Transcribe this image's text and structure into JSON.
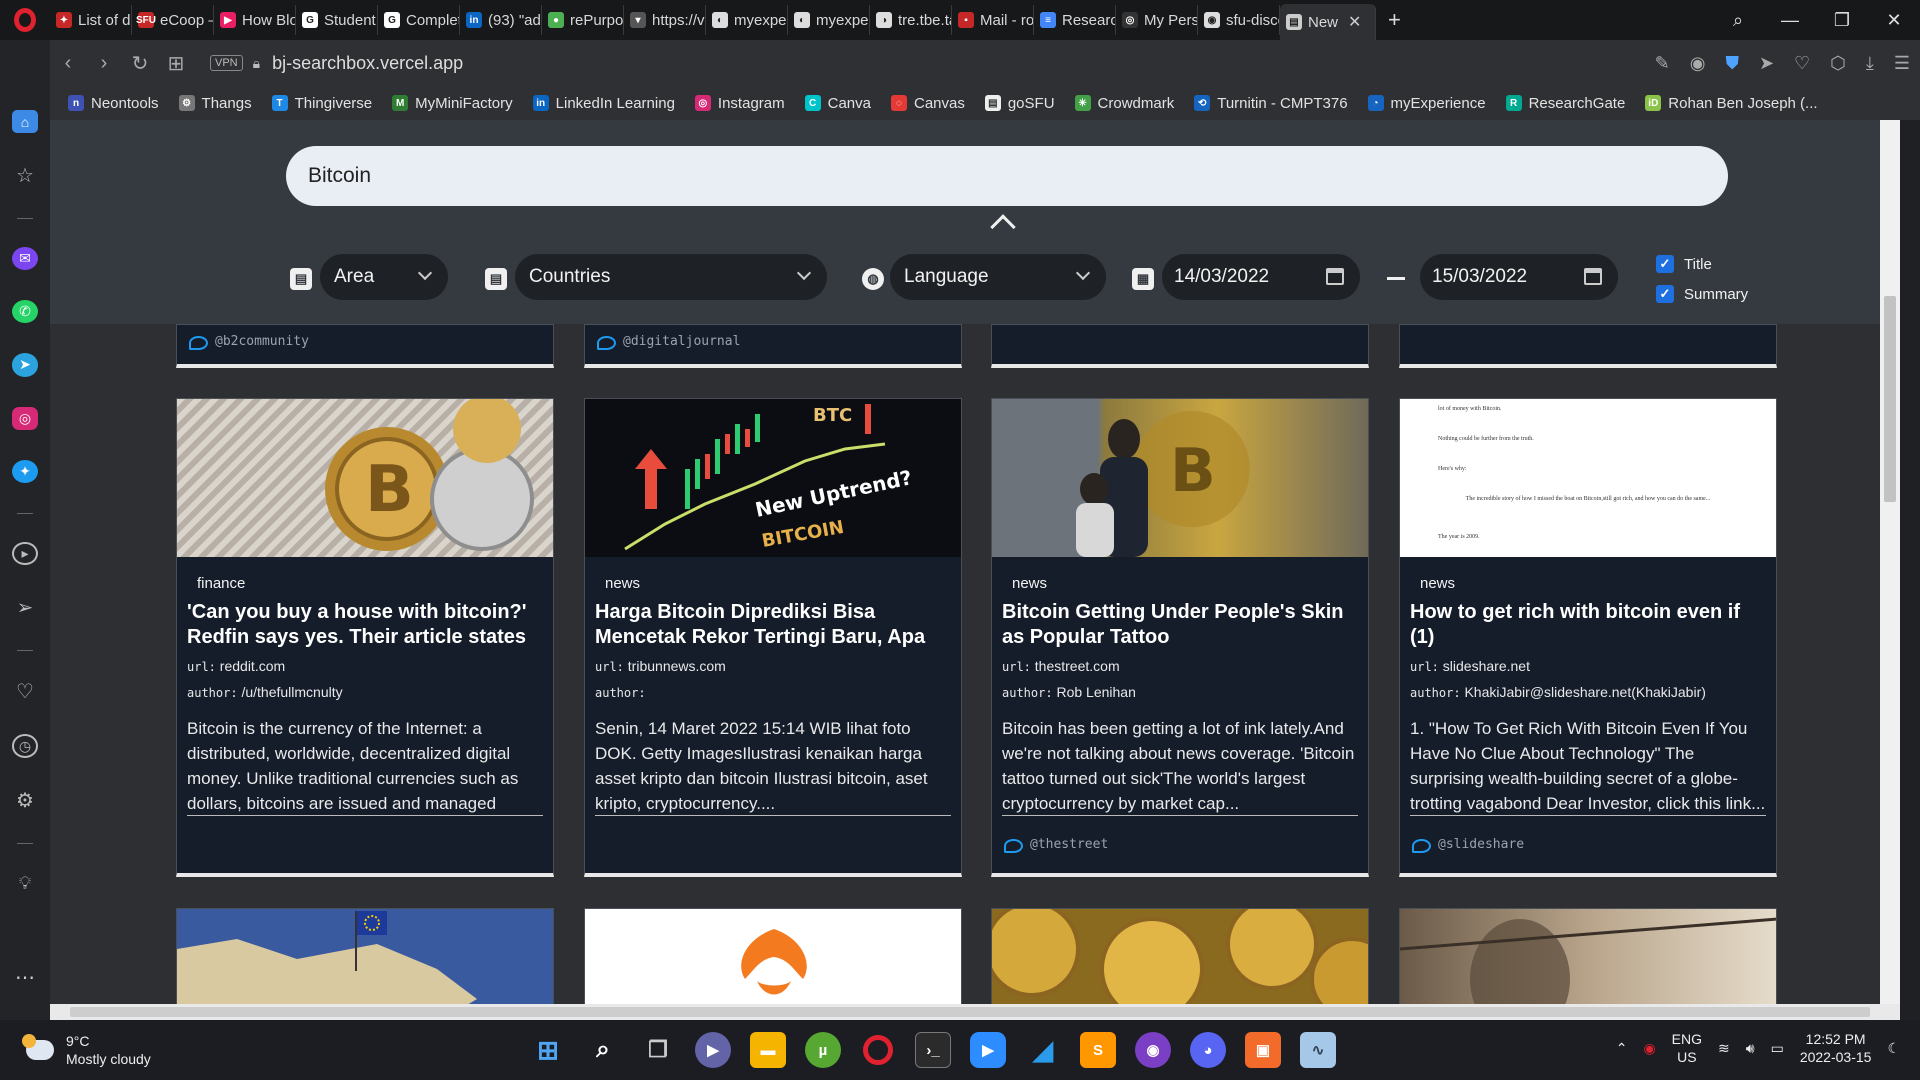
{
  "browser": {
    "tabs": [
      {
        "title": "List of d",
        "color": "#c62828",
        "glyph": "✦"
      },
      {
        "title": "eCoop –",
        "color": "#c62828",
        "glyph": "SFU"
      },
      {
        "title": "How Blo",
        "color": "#e91e63",
        "glyph": "▶"
      },
      {
        "title": "Student",
        "color": "#ffffff",
        "glyph": "G"
      },
      {
        "title": "Complet",
        "color": "#ffffff",
        "glyph": "G"
      },
      {
        "title": "(93) \"adi",
        "color": "#0a66c2",
        "glyph": "in"
      },
      {
        "title": "rePurpo",
        "color": "#4caf50",
        "glyph": "●"
      },
      {
        "title": "https://v",
        "color": "#555555",
        "glyph": "▾"
      },
      {
        "title": "myexper",
        "color": "#dddddd",
        "glyph": "◐"
      },
      {
        "title": "myexper",
        "color": "#dddddd",
        "glyph": "◐"
      },
      {
        "title": "tre.tbe.ta",
        "color": "#dddddd",
        "glyph": "◑"
      },
      {
        "title": "Mail - ro",
        "color": "#c62828",
        "glyph": "▪"
      },
      {
        "title": "Research",
        "color": "#4285f4",
        "glyph": "≡"
      },
      {
        "title": "My Perso",
        "color": "#333333",
        "glyph": "◎"
      },
      {
        "title": "sfu-disco",
        "color": "#dddddd",
        "glyph": "◉"
      },
      {
        "title": "New",
        "color": "#cccccc",
        "glyph": "▤",
        "active": true
      }
    ],
    "url": "bj-searchbox.vercel.app",
    "vpn_label": "VPN",
    "bookmarks": [
      {
        "label": "Neontools",
        "color": "#3f51b5",
        "glyph": "n"
      },
      {
        "label": "Thangs",
        "color": "#777777",
        "glyph": "⚙"
      },
      {
        "label": "Thingiverse",
        "color": "#1e88e5",
        "glyph": "T"
      },
      {
        "label": "MyMiniFactory",
        "color": "#2e7d32",
        "glyph": "M"
      },
      {
        "label": "LinkedIn Learning",
        "color": "#0a66c2",
        "glyph": "in"
      },
      {
        "label": "Instagram",
        "color": "#d62976",
        "glyph": "◎"
      },
      {
        "label": "Canva",
        "color": "#00c4cc",
        "glyph": "C"
      },
      {
        "label": "Canvas",
        "color": "#e53935",
        "glyph": "◌"
      },
      {
        "label": "goSFU",
        "color": "#eeeeee",
        "glyph": "▤"
      },
      {
        "label": "Crowdmark",
        "color": "#43a047",
        "glyph": "✳"
      },
      {
        "label": "Turnitin - CMPT376",
        "color": "#1565c0",
        "glyph": "⟲"
      },
      {
        "label": "myExperience",
        "color": "#1565c0",
        "glyph": "◔"
      },
      {
        "label": "ResearchGate",
        "color": "#00a98f",
        "glyph": "R"
      },
      {
        "label": "Rohan Ben Joseph (...",
        "color": "#8bc34a",
        "glyph": "iD"
      }
    ]
  },
  "search": {
    "query": "Bitcoin",
    "area_label": "Area",
    "countries_label": "Countries",
    "language_label": "Language",
    "date_from": "14/03/2022",
    "date_to": "15/03/2022",
    "title_checkbox": "Title",
    "summary_checkbox": "Summary"
  },
  "top_cards": [
    {
      "handle": "@b2community"
    },
    {
      "handle": "@digitaljournal"
    },
    {
      "handle": ""
    },
    {
      "handle": ""
    }
  ],
  "cards": [
    {
      "category": "finance",
      "title": "'Can you buy a house with bitcoin?' Redfin says yes. Their article states that ...",
      "url_label": "url:",
      "url": "reddit.com",
      "author_label": "author:",
      "author": "/u/thefullmcnulty",
      "summary": "Bitcoin is the currency of the Internet: a distributed, worldwide, decentralized digital money. Unlike traditional currencies such as dollars, bitcoins are issued and managed without any central authority.",
      "handle": ""
    },
    {
      "category": "news",
      "title": "Harga Bitcoin Diprediksi Bisa Mencetak Rekor Tertingi Baru, Apa Sebabnya?",
      "url_label": "url:",
      "url": "tribunnews.com",
      "author_label": "author:",
      "author": "",
      "summary": "Senin, 14 Maret 2022 15:14 WIB lihat foto DOK. Getty ImagesIlustrasi kenaikan harga asset kripto dan bitcoin  Ilustrasi bitcoin, aset kripto, cryptocurrency....",
      "handle": ""
    },
    {
      "category": "news",
      "title": "Bitcoin Getting Under People's Skin as Popular Tattoo",
      "url_label": "url:",
      "url": "thestreet.com",
      "author_label": "author:",
      "author": "Rob Lenihan",
      "summary": "Bitcoin has been getting a lot of ink lately.And we're not talking about news coverage. 'Bitcoin tattoo turned out sick'The world's largest cryptocurrency by market cap...",
      "handle": "@thestreet"
    },
    {
      "category": "news",
      "title": "How to get rich with bitcoin even if (1)",
      "url_label": "url:",
      "url": "slideshare.net",
      "author_label": "author:",
      "author": "KhakiJabir@slideshare.net(KhakiJabir)",
      "summary": "1. \"How To Get Rich With Bitcoin Even If You Have No Clue About Technology\" The surprising wealth-building secret of a globe-trotting vagabond Dear Investor, click this link...",
      "handle": "@slideshare"
    }
  ],
  "thumb_text": {
    "btc": "BTC",
    "uptrend": "New Uptrend?",
    "bitcoin": "BITCOIN",
    "doc_lines": [
      "lot of money with Bitcoin.",
      "Nothing could be further from the truth.",
      "Here's why:",
      "The incredible story of how I missed the boat on Bitcoin,still got rich, and how you can do the same...",
      "The year is 2009."
    ]
  },
  "taskbar": {
    "temp": "9°C",
    "weather": "Mostly cloudy",
    "lang": "ENG",
    "region": "US",
    "time": "12:52 PM",
    "date": "2022-03-15"
  }
}
